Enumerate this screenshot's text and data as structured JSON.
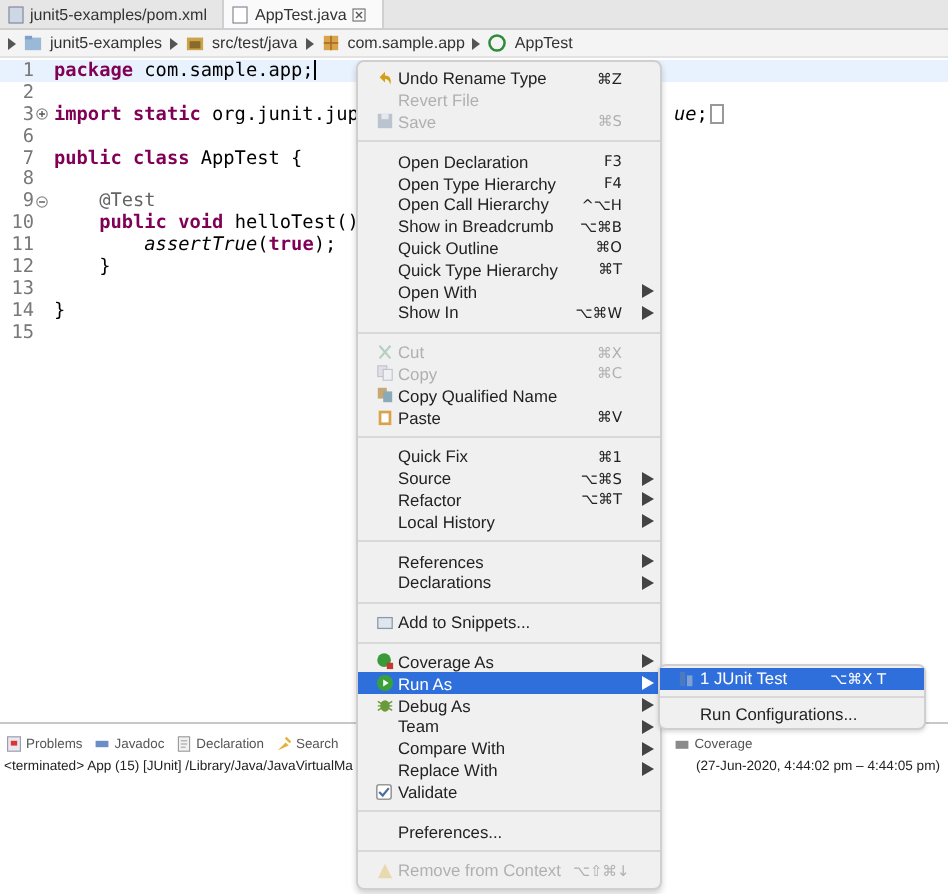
{
  "editor_tabs": [
    {
      "label": "junit5-examples/pom.xml",
      "selected": false
    },
    {
      "label": "AppTest.java",
      "selected": true
    }
  ],
  "breadcrumb": [
    {
      "label": "junit5-examples"
    },
    {
      "label": "src/test/java"
    },
    {
      "label": "com.sample.app"
    },
    {
      "label": "AppTest"
    }
  ],
  "code_lines": [
    {
      "number": "1",
      "current": true,
      "tokens": [
        {
          "text": "package",
          "kind": "keyword"
        },
        {
          "text": " com.sample.app;",
          "kind": "plain"
        }
      ]
    },
    {
      "number": "2"
    },
    {
      "number": "3",
      "collapsed": true,
      "tokens": [
        {
          "text": "import static",
          "kind": "keyword"
        },
        {
          "text": " org.junit.jup",
          "kind": "plain"
        }
      ],
      "tail": [
        {
          "text": "ue",
          "kind": "italic"
        },
        {
          "text": ";",
          "kind": "plain"
        }
      ]
    },
    {
      "number": "6"
    },
    {
      "number": "7",
      "tokens": [
        {
          "text": "public class",
          "kind": "keyword"
        },
        {
          "text": " AppTest {",
          "kind": "plain"
        }
      ]
    },
    {
      "number": "8"
    },
    {
      "number": "9",
      "collapsed": false,
      "tokens": [
        {
          "text": "    @Test",
          "kind": "annotation"
        }
      ]
    },
    {
      "number": "10",
      "tokens": [
        {
          "text": "    public void",
          "kind": "keyword"
        },
        {
          "text": " helloTest()",
          "kind": "plain"
        }
      ]
    },
    {
      "number": "11",
      "tokens": [
        {
          "text": "        assertTrue",
          "kind": "italic"
        },
        {
          "text": "(",
          "kind": "plain"
        },
        {
          "text": "true",
          "kind": "keyword"
        },
        {
          "text": ");",
          "kind": "plain"
        }
      ]
    },
    {
      "number": "12",
      "tokens": [
        {
          "text": "    }",
          "kind": "plain"
        }
      ]
    },
    {
      "number": "13"
    },
    {
      "number": "14",
      "tokens": [
        {
          "text": "}",
          "kind": "plain"
        }
      ]
    },
    {
      "number": "15"
    }
  ],
  "panel_tabs": [
    {
      "label": "Problems"
    },
    {
      "label": "Javadoc"
    },
    {
      "label": "Declaration"
    },
    {
      "label": "Search"
    },
    {
      "label": "Coverage"
    }
  ],
  "console": {
    "status": "<terminated> App (15) [JUnit] /Library/Java/JavaVirtualMa",
    "time": "(27-Jun-2020, 4:44:02 pm – 4:44:05 pm)"
  },
  "context_menu": [
    {
      "kind": "undo",
      "label": "Undo Rename Type",
      "shortcut": "⌘Z",
      "disabled": false,
      "selected": false
    },
    {
      "kind": "plain",
      "label": "Revert File",
      "disabled": true,
      "selected": false
    },
    {
      "kind": "save",
      "label": "Save",
      "shortcut": "⌘S",
      "disabled": true,
      "selected": false
    },
    {
      "kind": "separator"
    },
    {
      "kind": "plain",
      "label": "Open Declaration",
      "shortcut": "F3",
      "disabled": false,
      "selected": false
    },
    {
      "kind": "plain",
      "label": "Open Type Hierarchy",
      "shortcut": "F4",
      "disabled": false,
      "selected": false
    },
    {
      "kind": "plain",
      "label": "Open Call Hierarchy",
      "shortcut": "^⌥H",
      "disabled": false,
      "selected": false
    },
    {
      "kind": "plain",
      "label": "Show in Breadcrumb",
      "shortcut": "⌥⌘B",
      "disabled": false,
      "selected": false
    },
    {
      "kind": "plain",
      "label": "Quick Outline",
      "shortcut": "⌘O",
      "disabled": false,
      "selected": false
    },
    {
      "kind": "plain",
      "label": "Quick Type Hierarchy",
      "shortcut": "⌘T",
      "disabled": false,
      "selected": false
    },
    {
      "kind": "plain",
      "label": "Open With",
      "submenu": true,
      "disabled": false,
      "selected": false
    },
    {
      "kind": "plain",
      "label": "Show In",
      "shortcut": "⌥⌘W",
      "submenu": true,
      "disabled": false,
      "selected": false
    },
    {
      "kind": "separator"
    },
    {
      "kind": "cut",
      "label": "Cut",
      "shortcut": "⌘X",
      "disabled": true,
      "selected": false
    },
    {
      "kind": "copy",
      "label": "Copy",
      "shortcut": "⌘C",
      "disabled": true,
      "selected": false
    },
    {
      "kind": "copyname",
      "label": "Copy Qualified Name",
      "disabled": false,
      "selected": false
    },
    {
      "kind": "paste",
      "label": "Paste",
      "shortcut": "⌘V",
      "disabled": false,
      "selected": false
    },
    {
      "kind": "separator"
    },
    {
      "kind": "plain",
      "label": "Quick Fix",
      "shortcut": "⌘1",
      "disabled": false,
      "selected": false
    },
    {
      "kind": "plain",
      "label": "Source",
      "shortcut": "⌥⌘S",
      "submenu": true,
      "disabled": false,
      "selected": false
    },
    {
      "kind": "plain",
      "label": "Refactor",
      "shortcut": "⌥⌘T",
      "submenu": true,
      "disabled": false,
      "selected": false
    },
    {
      "kind": "plain",
      "label": "Local History",
      "submenu": true,
      "disabled": false,
      "selected": false
    },
    {
      "kind": "separator"
    },
    {
      "kind": "plain",
      "label": "References",
      "submenu": true,
      "disabled": false,
      "selected": false
    },
    {
      "kind": "plain",
      "label": "Declarations",
      "submenu": true,
      "disabled": false,
      "selected": false
    },
    {
      "kind": "separator"
    },
    {
      "kind": "snippet",
      "label": "Add to Snippets...",
      "disabled": false,
      "selected": false
    },
    {
      "kind": "separator"
    },
    {
      "kind": "coverage",
      "label": "Coverage As",
      "submenu": true,
      "disabled": false,
      "selected": false
    },
    {
      "kind": "run",
      "label": "Run As",
      "submenu": true,
      "disabled": false,
      "selected": true
    },
    {
      "kind": "debug",
      "label": "Debug As",
      "submenu": true,
      "disabled": false,
      "selected": false
    },
    {
      "kind": "plain",
      "label": "Team",
      "submenu": true,
      "disabled": false,
      "selected": false
    },
    {
      "kind": "plain",
      "label": "Compare With",
      "submenu": true,
      "disabled": false,
      "selected": false
    },
    {
      "kind": "plain",
      "label": "Replace With",
      "submenu": true,
      "disabled": false,
      "selected": false
    },
    {
      "kind": "check",
      "label": "Validate",
      "checked": true,
      "disabled": false,
      "selected": false
    },
    {
      "kind": "separator"
    },
    {
      "kind": "plain",
      "label": "Preferences...",
      "disabled": false,
      "selected": false
    },
    {
      "kind": "separator"
    },
    {
      "kind": "remove",
      "label": "Remove from Context",
      "shortcut": "⌥⇧⌘↓",
      "disabled": true,
      "selected": false
    }
  ],
  "submenu": [
    {
      "kind": "junit",
      "label": "1 JUnit Test",
      "shortcut": "⌥⌘X T",
      "selected": true
    },
    {
      "kind": "separator"
    },
    {
      "kind": "plain",
      "label": "Run Configurations...",
      "selected": false
    }
  ]
}
